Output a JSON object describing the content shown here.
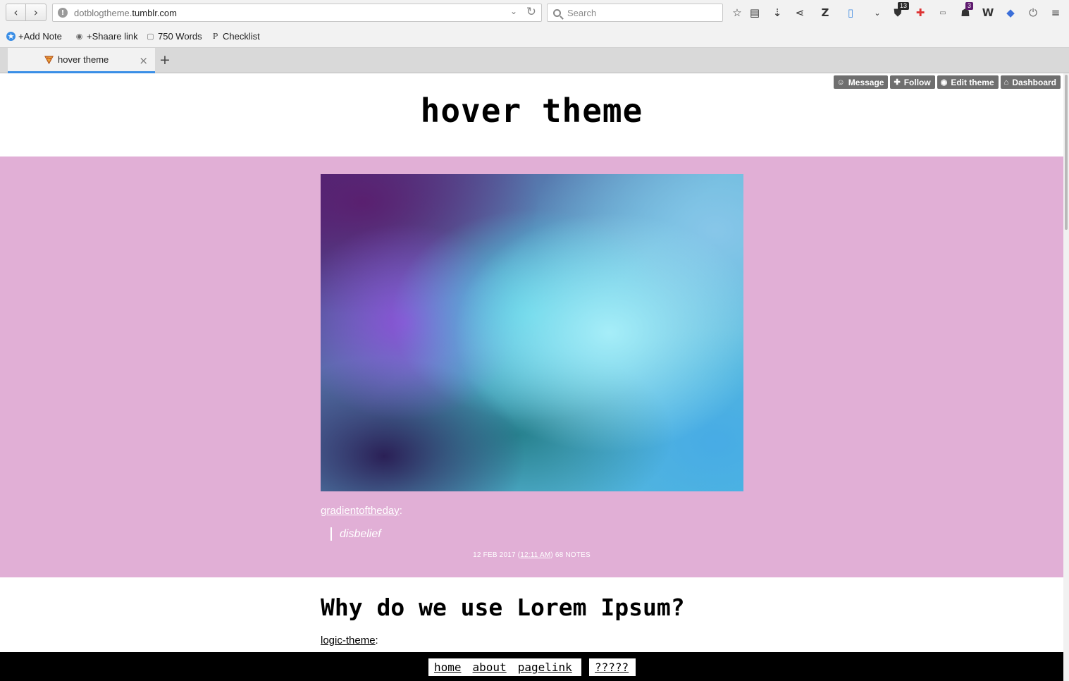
{
  "browser": {
    "url_prefix": "dotblogtheme.",
    "url_host": "tumblr.com",
    "search_placeholder": "Search",
    "badges": {
      "extension1": "13",
      "extension2": "3"
    },
    "bookmarks": [
      {
        "label": "+Add Note",
        "icon": "star-badge-icon"
      },
      {
        "label": "+Shaare link",
        "icon": "globe-icon"
      },
      {
        "label": "750 Words",
        "icon": "page-icon"
      },
      {
        "label": "Checklist",
        "icon": "pinboard-icon"
      }
    ],
    "tab": {
      "title": "hover theme"
    },
    "colors": {
      "tab_accent": "#3a8ee6"
    }
  },
  "page": {
    "controls": {
      "message": "Message",
      "follow": "Follow",
      "edit_theme": "Edit theme",
      "dashboard": "Dashboard"
    },
    "blog_title": "hover theme",
    "post1": {
      "source": "gradientoftheday",
      "quote": "disbelief",
      "date": "12 FEB 2017",
      "time": "12:11 AM",
      "notes": "68 NOTES",
      "bg_color": "#e1afd6"
    },
    "post2": {
      "title": "Why do we use Lorem Ipsum?",
      "source": "logic-theme"
    },
    "footer": {
      "links": [
        "home",
        "about",
        "pagelink"
      ],
      "extra": "?????"
    }
  }
}
